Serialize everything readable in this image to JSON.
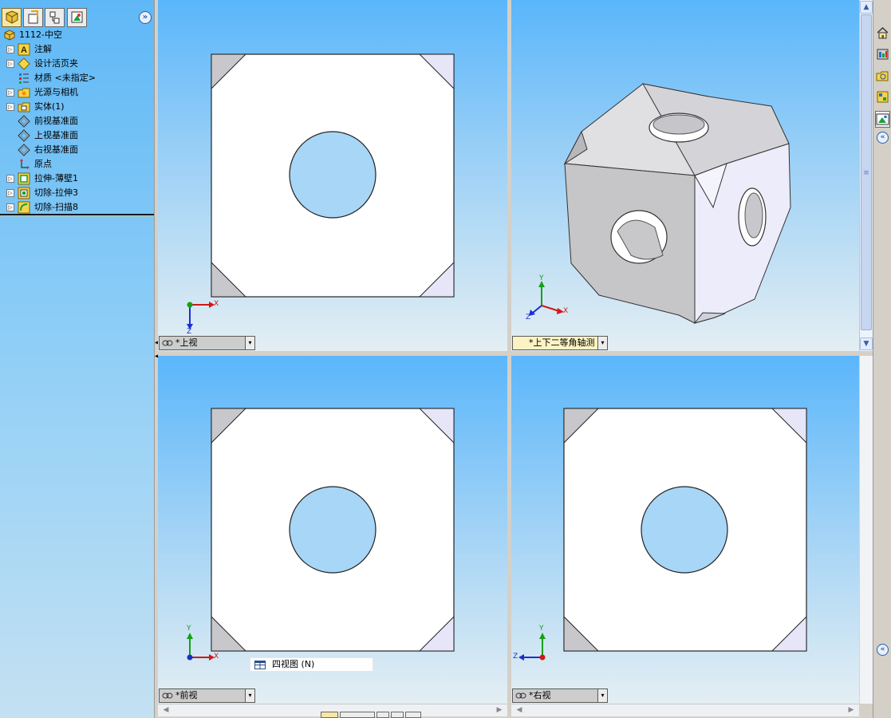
{
  "feature_tree": {
    "root": "1112-中空",
    "items": [
      {
        "label": "注解",
        "expandable": true
      },
      {
        "label": "设计活页夹",
        "expandable": true
      },
      {
        "label": "材质 <未指定>",
        "expandable": false
      },
      {
        "label": "光源与相机",
        "expandable": true
      },
      {
        "label": "实体(1)",
        "expandable": true
      },
      {
        "label": "前视基准面",
        "expandable": false
      },
      {
        "label": "上视基准面",
        "expandable": false
      },
      {
        "label": "右视基准面",
        "expandable": false
      },
      {
        "label": "原点",
        "expandable": false
      },
      {
        "label": "拉伸-薄壁1",
        "expandable": true
      },
      {
        "label": "切除-拉伸3",
        "expandable": true
      },
      {
        "label": "切除-扫描8",
        "expandable": true
      }
    ],
    "more_glyph": "»",
    "expander_glyph": "▷"
  },
  "viewports": {
    "top_left": {
      "label": "*上视"
    },
    "top_right": {
      "label": "*上下二等角轴测"
    },
    "bottom_left": {
      "label": "*前视"
    },
    "bottom_right": {
      "label": "*右视"
    },
    "dropdown_glyph": "▾"
  },
  "axes": {
    "x": "X",
    "y": "Y",
    "z": "Z"
  },
  "tooltip": {
    "label": "四视图 (N)"
  },
  "taskpane": {
    "collapse_glyph": "«"
  },
  "scroll": {
    "up": "▲",
    "down": "▼",
    "left": "◀",
    "right": "▶",
    "grip": "≡"
  },
  "colors": {
    "viewport_top": "#5ab6fb",
    "model_face": "#ffffff",
    "model_shade": "#c8c8cc",
    "model_side": "#e6e6f8",
    "hole": "#a7d6f6",
    "axis_x": "#d01818",
    "axis_y": "#17a017",
    "axis_z": "#1a2fd0"
  }
}
